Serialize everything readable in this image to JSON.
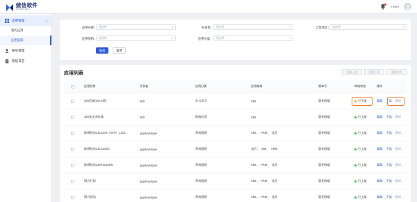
{
  "brand": {
    "name_cn": "统信软件",
    "name_en": "UNIONTECH"
  },
  "header": {
    "username": "root",
    "icons": [
      "bell-icon",
      "avatar-icon"
    ],
    "notification_dot_color": "#e23b3b"
  },
  "sidebar": {
    "group_label": "应用管理",
    "sub_items": [
      {
        "label": "我的应用",
        "active": false
      },
      {
        "label": "应用追踪",
        "active": true
      }
    ],
    "items": [
      {
        "label": "帐号管理",
        "icon": "user-icon"
      },
      {
        "label": "系统日志",
        "icon": "log-icon"
      }
    ]
  },
  "filters": {
    "app_name_label": "应用名称：",
    "app_name_placeholder": "请选择",
    "developer_label": "开发者：",
    "developer_placeholder": "请选择",
    "listing_status_label": "上架状态：",
    "listing_status_placeholder": "请选择",
    "app_arch_label": "应用架构：",
    "app_arch_placeholder": "请选择",
    "app_category_label": "应用分类：",
    "app_category_placeholder": "请选择",
    "query_button": "查询",
    "reset_button": "重置"
  },
  "list": {
    "title": "应用列表",
    "bulk_actions": [
      "批量上架",
      "批量下架",
      "删除应用"
    ],
    "columns": [
      "应用名称",
      "开发者",
      "应用分类",
      "应用架构",
      "版本号",
      "审核状态",
      "操作"
    ],
    "rows": [
      {
        "name": "360压缩(Linux版)",
        "developer": "360",
        "category": "办公学习",
        "arch": "X86",
        "version": "暂无数据",
        "status": "已下架",
        "status_color": "#f0a020",
        "actions": [
          "编辑",
          "上架",
          "删除"
        ],
        "highlight": true
      },
      {
        "name": "360安全浏览器",
        "developer": "360",
        "category": "网络应用",
        "arch": "X86",
        "version": "暂无数据",
        "status": "已上架",
        "status_color": "#2fb04a",
        "actions": [
          "编辑",
          "下架",
          "删除"
        ],
        "highlight": false
      },
      {
        "name": "联想驱动LJ2310N（SFP）LJ23...",
        "developer": "appdeveloper",
        "category": "系统管理",
        "arch": "X86 、 ARM 、 龙芯",
        "version": "暂无数据",
        "status": "已上架",
        "status_color": "#2fb04a",
        "actions": [
          "编辑",
          "下架",
          "删除"
        ],
        "highlight": false
      },
      {
        "name": "联想驱动LJ3310DN",
        "developer": "appdeveloper",
        "category": "系统管理",
        "arch": "龙芯 、 X86 、 ARM",
        "version": "暂无数据",
        "status": "已上架",
        "status_color": "#2fb04a",
        "actions": [
          "编辑",
          "下架",
          "删除"
        ],
        "highlight": false
      },
      {
        "name": "联想驱动LJ6P3310DN",
        "developer": "appdeveloper",
        "category": "系统管理",
        "arch": "X86 、 ARM 、 龙芯",
        "version": "暂无数据",
        "status": "已上架",
        "status_color": "#2fb04a",
        "actions": [
          "编辑",
          "下架",
          "删除"
        ],
        "highlight": false
      },
      {
        "name": "得力打印",
        "developer": "appdeveloper",
        "category": "系统管理",
        "arch": "X86 、 ARM 、 龙芯",
        "version": "暂无数据",
        "status": "已上架",
        "status_color": "#2fb04a",
        "actions": [
          "编辑",
          "下架",
          "删除"
        ],
        "highlight": false
      },
      {
        "name": "得力驱动",
        "developer": "appdeveloper",
        "category": "系统管理",
        "arch": "X86 、 ARM 、 龙芯",
        "version": "暂无数据",
        "status": "已上架",
        "status_color": "#2fb04a",
        "actions": [
          "编辑",
          "下架",
          "删除"
        ],
        "highlight": false
      }
    ]
  },
  "colors": {
    "primary": "#2f5bdc",
    "highlight_box": "#f07a2a",
    "status_listed": "#2fb04a",
    "status_unlisted": "#f0a020"
  }
}
